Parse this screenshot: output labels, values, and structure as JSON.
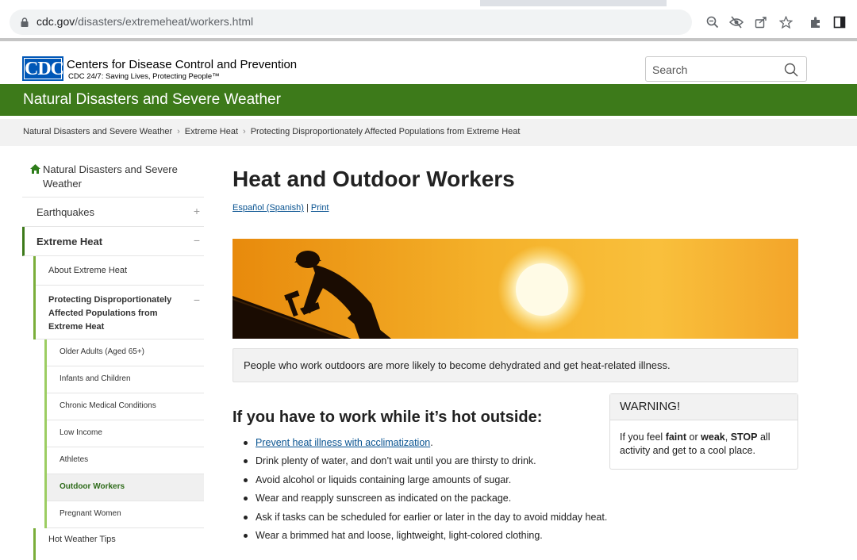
{
  "browser": {
    "url_host": "cdc.gov",
    "url_path": "/disasters/extremeheat/workers.html"
  },
  "header": {
    "logo_text": "CDC",
    "org_name": "Centers for Disease Control and Prevention",
    "tagline": "CDC 24/7: Saving Lives, Protecting People™",
    "search_placeholder": "Search"
  },
  "banner": {
    "title": "Natural Disasters and Severe Weather"
  },
  "breadcrumb": [
    "Natural Disasters and Severe Weather",
    "Extreme Heat",
    "Protecting Disproportionately Affected Populations from Extreme Heat"
  ],
  "sidebar": {
    "home_label": "Natural Disasters and Severe Weather",
    "earthquakes": "Earthquakes",
    "extreme_heat": "Extreme Heat",
    "about": "About Extreme Heat",
    "protecting": "Protecting Disproportionately Affected Populations from Extreme Heat",
    "sub_items": [
      "Older Adults (Aged 65+)",
      "Infants and Children",
      "Chronic Medical Conditions",
      "Low Income",
      "Athletes",
      "Outdoor Workers",
      "Pregnant Women"
    ],
    "hot_weather_tips": "Hot Weather Tips",
    "plus_symbol": "+",
    "minus_symbol": "−"
  },
  "main": {
    "title": "Heat and Outdoor Workers",
    "lang_link": "Español (Spanish)",
    "lang_sep": "|",
    "print_link": "Print",
    "callout": "People who work outdoors are more likely to become dehydrated and get heat-related illness.",
    "section_heading": "If you have to work while it’s hot outside:",
    "bullet_link": "Prevent heat illness with acclimatization",
    "bullet_link_suffix": ".",
    "bullets": [
      "Drink plenty of water, and don’t wait until you are thirsty to drink.",
      "Avoid alcohol or liquids containing large amounts of sugar.",
      "Wear and reapply sunscreen as indicated on the package.",
      "Ask if tasks can be scheduled for earlier or later in the day to avoid midday heat.",
      "Wear a brimmed hat and loose, lightweight, light-colored clothing."
    ]
  },
  "warning": {
    "title": "WARNING!",
    "text_1": "If you feel ",
    "bold_1": "faint",
    "text_2": " or ",
    "bold_2": "weak",
    "text_3": ", ",
    "bold_3": "STOP",
    "text_4": " all activity and get to a cool place."
  },
  "colors": {
    "banner_green": "#3d7a1a",
    "link_blue": "#075290",
    "cdc_blue": "#0057b7"
  }
}
